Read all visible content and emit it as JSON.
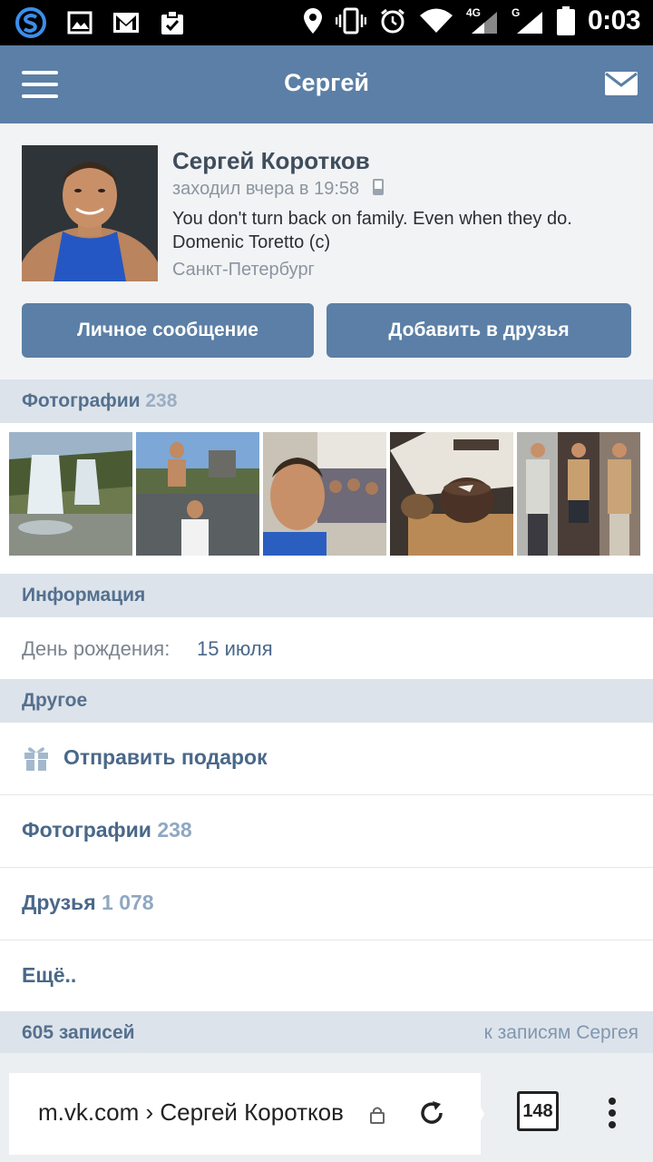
{
  "status_bar": {
    "time": "0:03",
    "network_a": "4G",
    "network_b": "G"
  },
  "header": {
    "title": "Сергей"
  },
  "profile": {
    "full_name": "Сергей Коротков",
    "last_seen": "заходил вчера в 19:58",
    "status_text": "You don't turn back on family. Even when they do. Domenic Toretto (c)",
    "city": "Санкт-Петербург",
    "message_button": "Личное сообщение",
    "add_friend_button": "Добавить в друзья"
  },
  "photos": {
    "label": "Фотографии",
    "count": "238"
  },
  "info": {
    "label": "Информация",
    "birthday_label": "День рождения:",
    "birthday_value": "15 июля"
  },
  "other": {
    "label": "Другое",
    "items": [
      {
        "label": "Отправить подарок"
      },
      {
        "label": "Фотографии",
        "count": "238"
      },
      {
        "label": "Друзья",
        "count": "1 078"
      },
      {
        "label": "Ещё.."
      }
    ]
  },
  "wall": {
    "count_label": "605 записей",
    "link_label": "к записям Сергея"
  },
  "browser": {
    "url": "m.vk.com › Сергей Коротков",
    "tab_count": "148"
  },
  "colors": {
    "accent": "#5b7fa6",
    "section_bg": "#dde3ea"
  }
}
